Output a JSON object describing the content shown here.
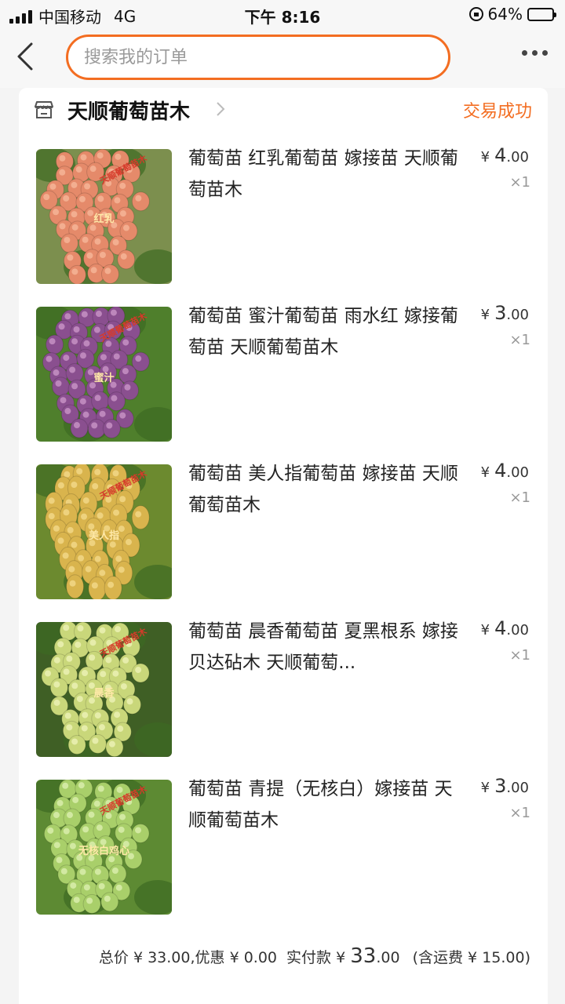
{
  "status_bar": {
    "carrier": "中国移动",
    "network": "4G",
    "time": "下午 8:16",
    "battery": "64%",
    "battery_level": 0.64
  },
  "nav": {
    "search_placeholder": "搜索我的订单"
  },
  "shop": {
    "name": "天顺葡萄苗木",
    "order_status": "交易成功"
  },
  "items": [
    {
      "title": "葡萄苗 红乳葡萄苗 嫁接苗 天顺葡萄苗木",
      "currency": "¥",
      "price_int": "4",
      "price_dec": ".00",
      "qty": "×1",
      "image_label": "红乳",
      "watermark": "天顺葡萄苗木",
      "colors": {
        "bg": "#7c8f4e",
        "fruit": "#e58a6a",
        "fruit_hi": "#f6b79a"
      }
    },
    {
      "title": "葡萄苗  蜜汁葡萄苗  雨水红  嫁接葡萄苗  天顺葡萄苗木",
      "currency": "¥",
      "price_int": "3",
      "price_dec": ".00",
      "qty": "×1",
      "image_label": "蜜汁",
      "watermark": "天顺葡萄苗木",
      "colors": {
        "bg": "#4f7f2c",
        "fruit": "#8a4f8f",
        "fruit_hi": "#c995c7"
      }
    },
    {
      "title": "葡萄苗  美人指葡萄苗   嫁接苗  天顺葡萄苗木",
      "currency": "¥",
      "price_int": "4",
      "price_dec": ".00",
      "qty": "×1",
      "image_label": "美人指",
      "watermark": "天顺葡萄苗木",
      "colors": {
        "bg": "#6c8a2f",
        "fruit": "#d9b44d",
        "fruit_hi": "#f2d98b"
      }
    },
    {
      "title": "葡萄苗 晨香葡萄苗  夏黑根系  嫁接  贝达砧木  天顺葡萄...",
      "currency": "¥",
      "price_int": "4",
      "price_dec": ".00",
      "qty": "×1",
      "image_label": "晨香",
      "watermark": "天顺葡萄苗木",
      "colors": {
        "bg": "#3f5f25",
        "fruit": "#c9d77a",
        "fruit_hi": "#eef3b8"
      }
    },
    {
      "title": "葡萄苗  青提（无核白）嫁接苗  天顺葡萄苗木",
      "currency": "¥",
      "price_int": "3",
      "price_dec": ".00",
      "qty": "×1",
      "image_label": "无核白鸡心",
      "watermark": "天顺葡萄苗木",
      "colors": {
        "bg": "#5d8a33",
        "fruit": "#a9cf6a",
        "fruit_hi": "#dcefb0"
      }
    }
  ],
  "summary": {
    "total_label": "总价",
    "total_value": "¥ 33.00",
    "discount_label": ",优惠",
    "discount_value": "¥ 0.00",
    "paid_label": "实付款",
    "paid_currency": "¥",
    "paid_int": "33",
    "paid_dec": ".00",
    "shipping": "(含运费 ¥ 15.00)"
  },
  "accent_color": "#f36d21"
}
